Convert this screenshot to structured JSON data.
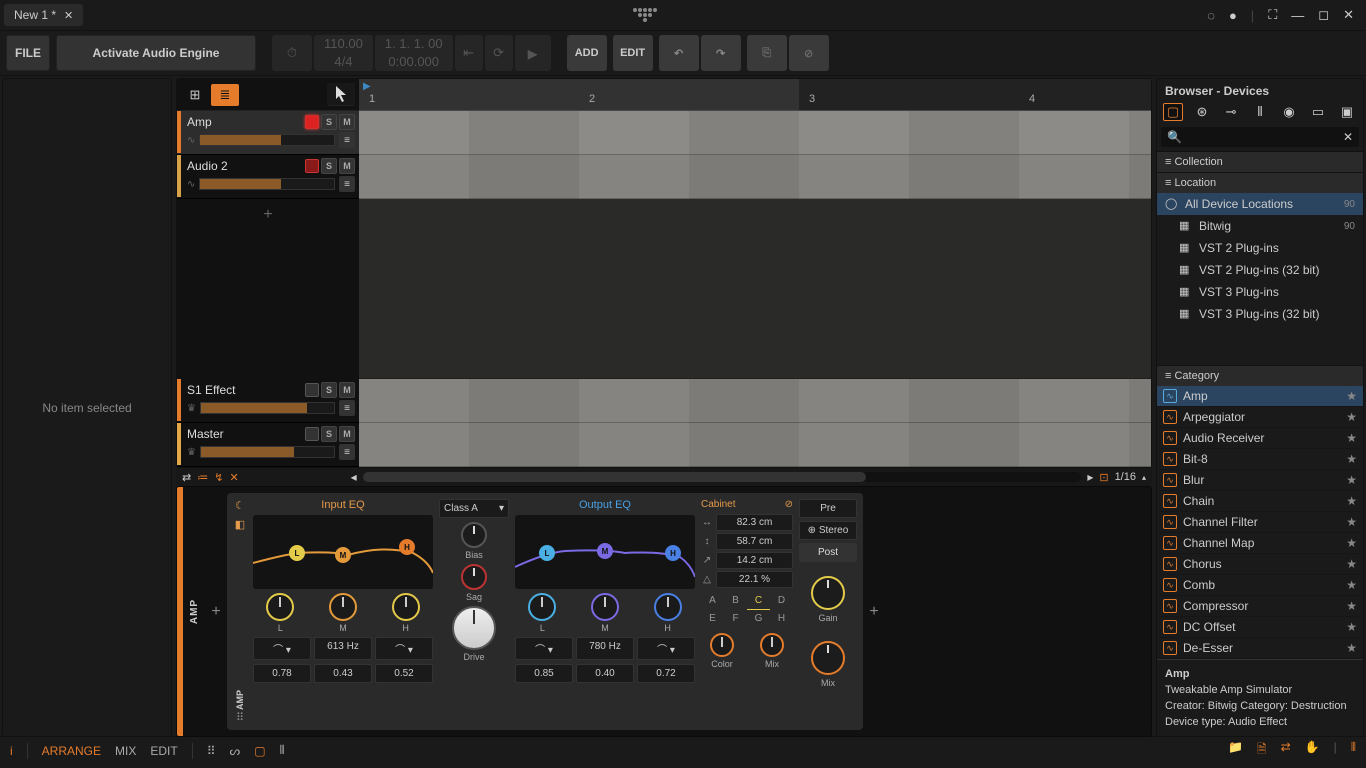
{
  "titlebar": {
    "tab": "New 1 *"
  },
  "toolbar": {
    "file": "FILE",
    "activate": "Activate Audio Engine",
    "tempo": "110.00",
    "timesig": "4/4",
    "position": "1. 1. 1. 00",
    "time": "0:00.000",
    "add": "ADD",
    "edit": "EDIT"
  },
  "left_panel": "No item selected",
  "tracks": [
    {
      "name": "Amp",
      "color": "#e47c2c",
      "vol": 60,
      "rec": true,
      "sel": true
    },
    {
      "name": "Audio 2",
      "color": "#d6a24a",
      "vol": 60,
      "rec": false,
      "sel": false
    }
  ],
  "fx_tracks": [
    {
      "name": "S1 Effect",
      "color": "#e47c2c",
      "vol": 80
    },
    {
      "name": "Master",
      "color": "#e4a84a",
      "vol": 70
    }
  ],
  "ruler": [
    "1",
    "2",
    "3",
    "4"
  ],
  "zoom": "1/16",
  "device": {
    "label_a": "AMP",
    "label_b": "AMP",
    "input_eq": "Input EQ",
    "output_eq": "Output EQ",
    "lmh": [
      "L",
      "M",
      "H"
    ],
    "in_freq": "613 Hz",
    "in_vals": [
      "0.78",
      "0.43",
      "0.52"
    ],
    "out_freq": "780 Hz",
    "out_vals": [
      "0.85",
      "0.40",
      "0.72"
    ],
    "class": "Class A",
    "bias": "Bias",
    "sag": "Sag",
    "drive": "Drive",
    "cabinet": "Cabinet",
    "cab_vals": [
      "82.3 cm",
      "58.7 cm",
      "14.2 cm",
      "22.1 %"
    ],
    "letters": [
      "A",
      "B",
      "C",
      "D",
      "E",
      "F",
      "G",
      "H"
    ],
    "color": "Color",
    "mix": "Mix",
    "pre": "Pre",
    "stereo": "Stereo",
    "post": "Post",
    "gain": "Gain"
  },
  "browser": {
    "title": "Browser - Devices",
    "collection": "Collection",
    "location": "Location",
    "all": "All Device Locations",
    "all_count": "90",
    "locations": [
      {
        "name": "Bitwig",
        "count": "90"
      },
      {
        "name": "VST 2 Plug-ins",
        "count": ""
      },
      {
        "name": "VST 2 Plug-ins (32 bit)",
        "count": ""
      },
      {
        "name": "VST 3 Plug-ins",
        "count": ""
      },
      {
        "name": "VST 3 Plug-ins (32 bit)",
        "count": ""
      }
    ],
    "category": "Category",
    "devices": [
      "Amp",
      "Arpeggiator",
      "Audio Receiver",
      "Bit-8",
      "Blur",
      "Chain",
      "Channel Filter",
      "Channel Map",
      "Chorus",
      "Comb",
      "Compressor",
      "DC Offset",
      "De-Esser"
    ],
    "info": {
      "name": "Amp",
      "desc": "Tweakable Amp Simulator",
      "meta1": "Creator: Bitwig    Category: Destruction",
      "meta2": "Device type: Audio Effect"
    }
  },
  "bottom": {
    "arrange": "ARRANGE",
    "mix": "MIX",
    "edit": "EDIT"
  }
}
